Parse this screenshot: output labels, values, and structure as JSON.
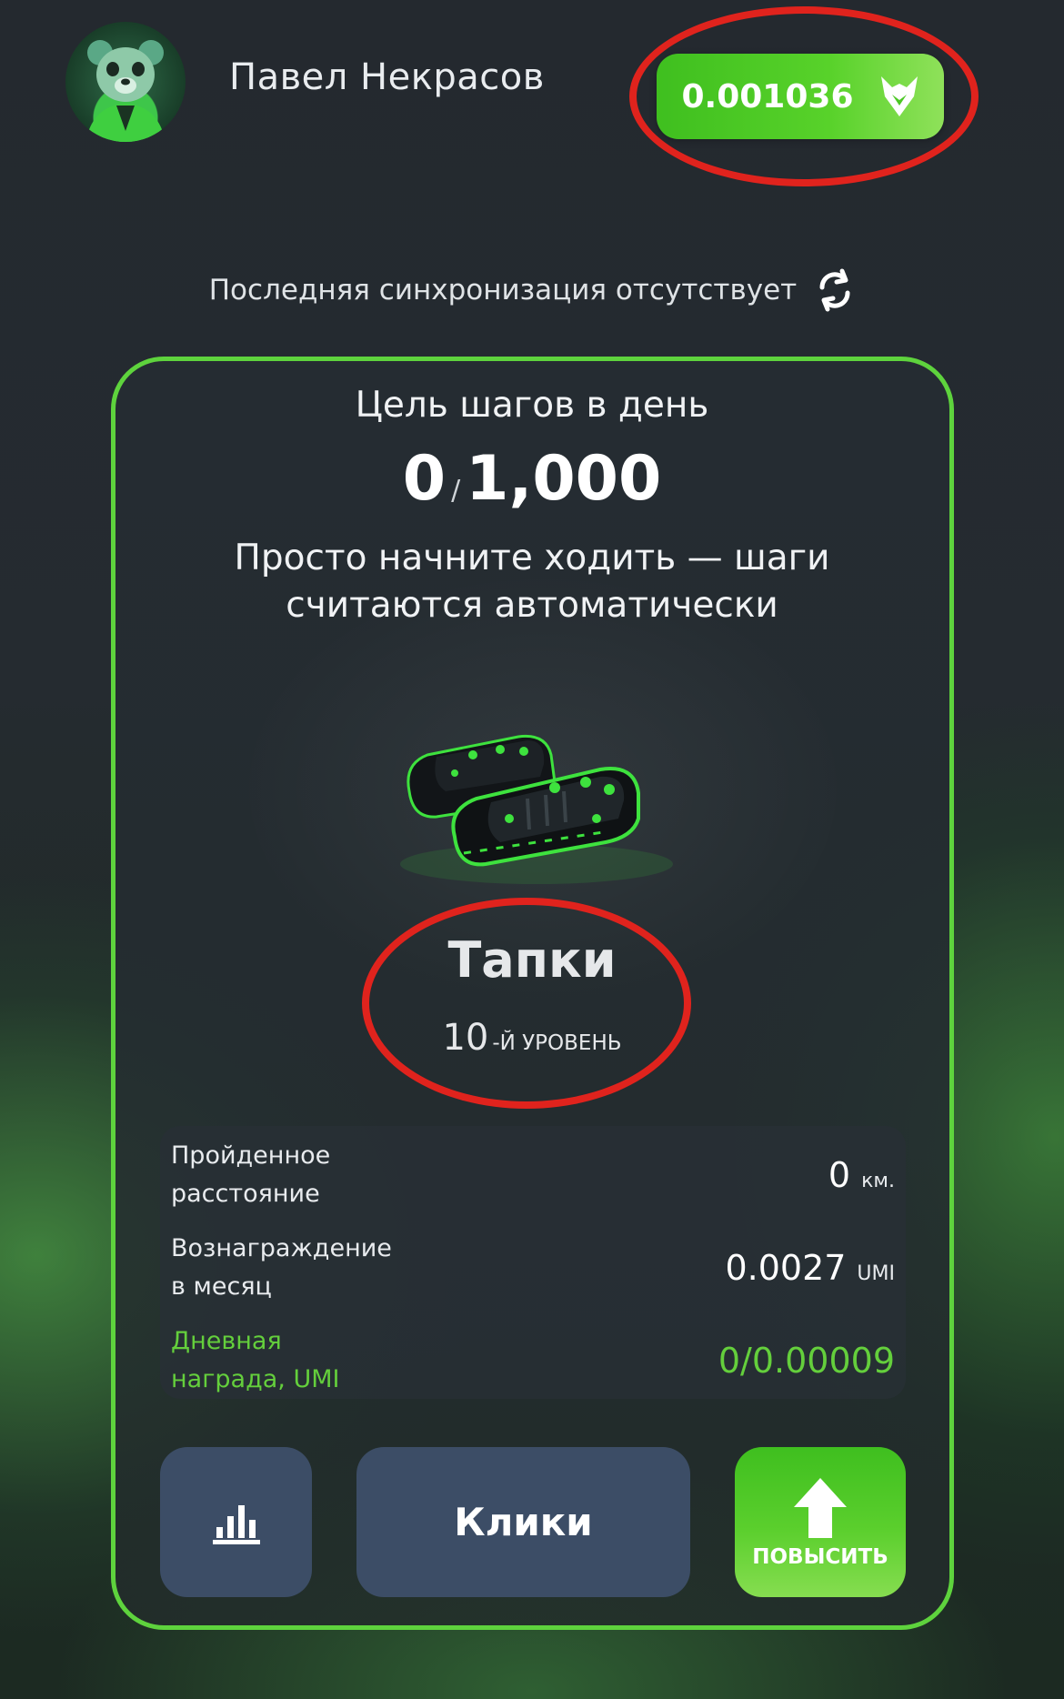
{
  "header": {
    "user_name": "Павел Некрасов",
    "balance": "0.001036",
    "balance_icon": "fox-logo-icon"
  },
  "sync": {
    "status_text": "Последняя синхронизация отсутствует",
    "icon": "refresh-icon"
  },
  "goal": {
    "title": "Цель шагов в день",
    "current": "0",
    "separator": "/",
    "target": "1,000",
    "hint": "Просто начните ходить — шаги считаются автоматически"
  },
  "item": {
    "image": "green-slippers-image",
    "name": "Тапки",
    "level_number": "10",
    "level_suffix": "-Й УРОВЕНЬ"
  },
  "stats": [
    {
      "label": "Пройденное расстояние",
      "value": "0",
      "unit": "км."
    },
    {
      "label": "Вознаграждение в месяц",
      "value": "0.0027",
      "unit": "UMI"
    },
    {
      "label": "Дневная награда, UMI",
      "value": "0/0.00009",
      "unit": ""
    }
  ],
  "buttons": {
    "stats_icon": "bar-chart-icon",
    "clicks_label": "Клики",
    "upgrade_label": "ПОВЫСИТЬ",
    "upgrade_icon": "arrow-up-icon"
  },
  "colors": {
    "accent_green": "#5ed33d",
    "annotation_red": "#e0231d",
    "button_blue": "#3c4d66"
  }
}
